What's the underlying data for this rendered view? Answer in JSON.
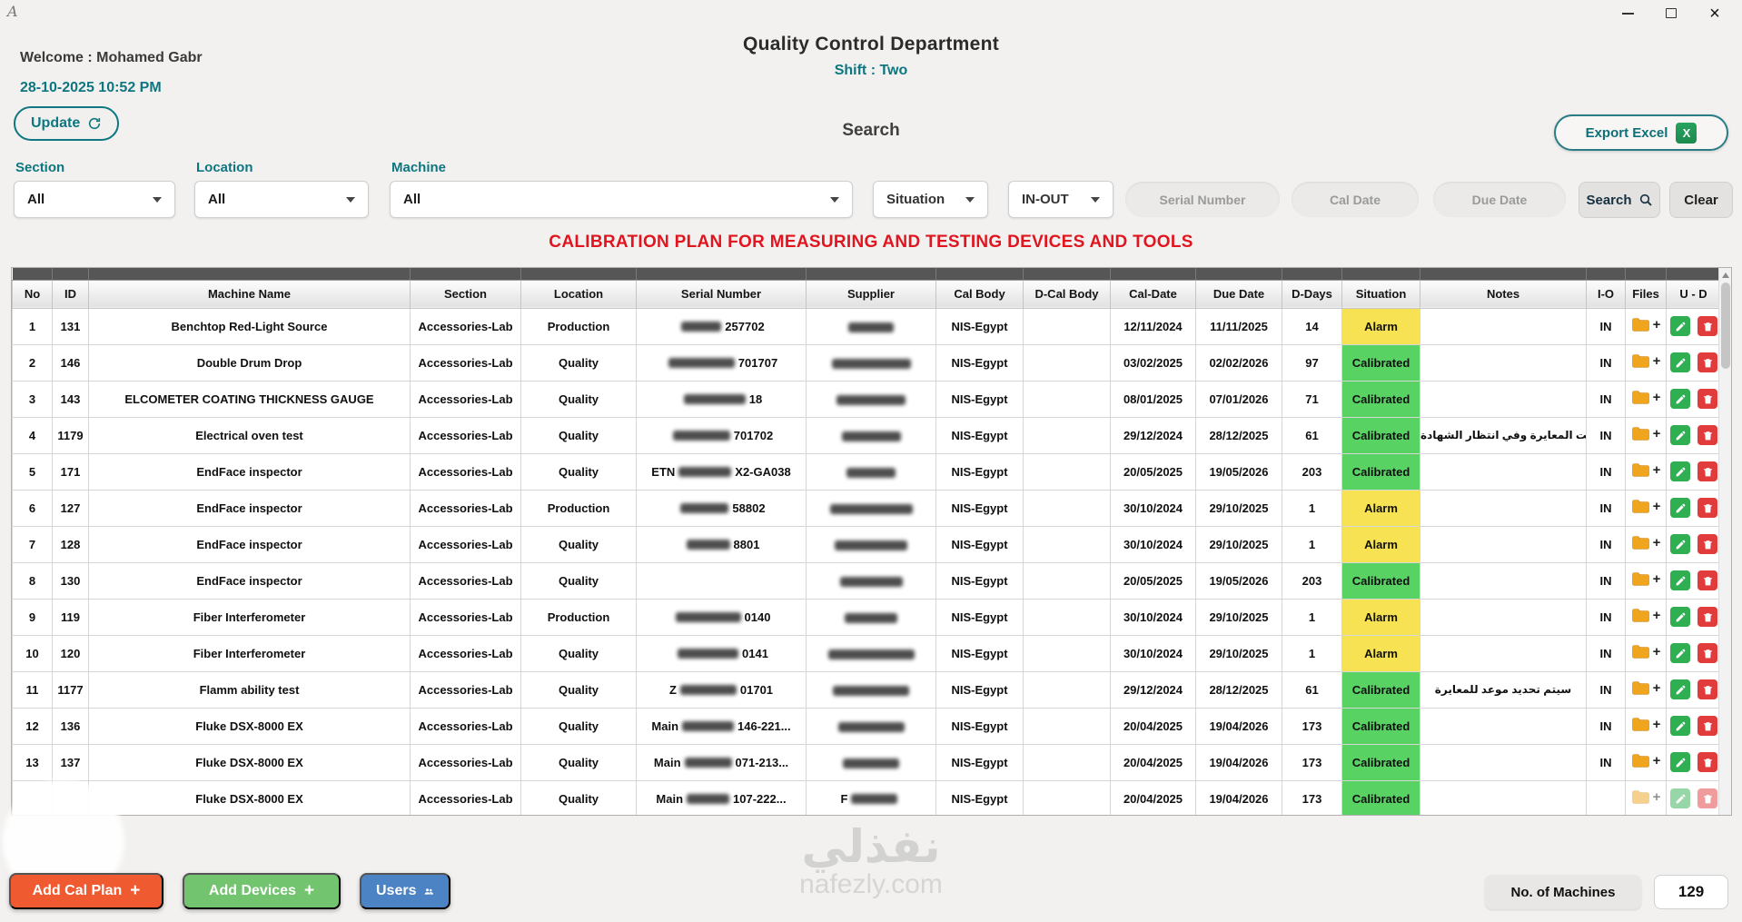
{
  "header": {
    "welcome": "Welcome : Mohamed Gabr",
    "datetime": "28-10-2025 10:52 PM",
    "title": "Quality Control Department",
    "shift": "Shift : Two",
    "update_label": "Update",
    "export_label": "Export Excel"
  },
  "search": {
    "heading": "Search",
    "section_label": "Section",
    "section_value": "All",
    "location_label": "Location",
    "location_value": "All",
    "machine_label": "Machine",
    "machine_value": "All",
    "situation_value": "Situation",
    "inout_value": "IN-OUT",
    "serial_placeholder": "Serial Number",
    "cal_date_placeholder": "Cal Date",
    "due_date_placeholder": "Due Date",
    "search_label": "Search",
    "clear_label": "Clear"
  },
  "table": {
    "title": "CALIBRATION PLAN FOR MEASURING AND TESTING DEVICES AND TOOLS",
    "columns": [
      "No",
      "ID",
      "Machine Name",
      "Section",
      "Location",
      "Serial Number",
      "Supplier",
      "Cal Body",
      "D-Cal Body",
      "Cal-Date",
      "Due Date",
      "D-Days",
      "Situation",
      "Notes",
      "I-O",
      "Files",
      "U - D"
    ],
    "situation_colors": {
      "Alarm": "#f6e253",
      "Calibrated": "#58d263"
    },
    "rows": [
      {
        "no": "1",
        "id": "131",
        "machine": "Benchtop Red-Light Source",
        "section": "Accessories-Lab",
        "location": "Production",
        "serial_pre": "",
        "serial_redacted": true,
        "serial_post": "257702",
        "supplier_pre": "",
        "supplier_redacted": true,
        "cal_body": "NIS-Egypt",
        "d_cal_body": "",
        "cal_date": "12/11/2024",
        "due_date": "11/11/2025",
        "d_days": "14",
        "situation": "Alarm",
        "notes": "",
        "io": "IN",
        "partial": false
      },
      {
        "no": "2",
        "id": "146",
        "machine": "Double Drum Drop",
        "section": "Accessories-Lab",
        "location": "Quality",
        "serial_pre": "",
        "serial_redacted": true,
        "serial_post": "701707",
        "supplier_pre": "",
        "supplier_redacted": true,
        "cal_body": "NIS-Egypt",
        "d_cal_body": "",
        "cal_date": "03/02/2025",
        "due_date": "02/02/2026",
        "d_days": "97",
        "situation": "Calibrated",
        "notes": "",
        "io": "IN",
        "partial": false
      },
      {
        "no": "3",
        "id": "143",
        "machine": "ELCOMETER COATING THICKNESS GAUGE",
        "section": "Accessories-Lab",
        "location": "Quality",
        "serial_pre": "",
        "serial_redacted": true,
        "serial_post": "18",
        "supplier_pre": "",
        "supplier_redacted": true,
        "cal_body": "NIS-Egypt",
        "d_cal_body": "",
        "cal_date": "08/01/2025",
        "due_date": "07/01/2026",
        "d_days": "71",
        "situation": "Calibrated",
        "notes": "",
        "io": "IN",
        "partial": false
      },
      {
        "no": "4",
        "id": "1179",
        "machine": "Electrical oven test",
        "section": "Accessories-Lab",
        "location": "Quality",
        "serial_pre": "",
        "serial_redacted": true,
        "serial_post": "701702",
        "supplier_pre": "",
        "supplier_redacted": true,
        "cal_body": "NIS-Egypt",
        "d_cal_body": "",
        "cal_date": "29/12/2024",
        "due_date": "28/12/2025",
        "d_days": "61",
        "situation": "Calibrated",
        "notes": "تمت المعايرة وفي انتظار الشهادة",
        "io": "IN",
        "partial": false
      },
      {
        "no": "5",
        "id": "171",
        "machine": "EndFace inspector",
        "section": "Accessories-Lab",
        "location": "Quality",
        "serial_pre": "ETN",
        "serial_redacted": true,
        "serial_post": "X2-GA038",
        "supplier_pre": "",
        "supplier_redacted": true,
        "cal_body": "NIS-Egypt",
        "d_cal_body": "",
        "cal_date": "20/05/2025",
        "due_date": "19/05/2026",
        "d_days": "203",
        "situation": "Calibrated",
        "notes": "",
        "io": "IN",
        "partial": false
      },
      {
        "no": "6",
        "id": "127",
        "machine": "EndFace inspector",
        "section": "Accessories-Lab",
        "location": "Production",
        "serial_pre": "",
        "serial_redacted": true,
        "serial_post": "58802",
        "supplier_pre": "",
        "supplier_redacted": true,
        "cal_body": "NIS-Egypt",
        "d_cal_body": "",
        "cal_date": "30/10/2024",
        "due_date": "29/10/2025",
        "d_days": "1",
        "situation": "Alarm",
        "notes": "",
        "io": "IN",
        "partial": false
      },
      {
        "no": "7",
        "id": "128",
        "machine": "EndFace inspector",
        "section": "Accessories-Lab",
        "location": "Quality",
        "serial_pre": "",
        "serial_redacted": true,
        "serial_post": "8801",
        "supplier_pre": "",
        "supplier_redacted": true,
        "cal_body": "NIS-Egypt",
        "d_cal_body": "",
        "cal_date": "30/10/2024",
        "due_date": "29/10/2025",
        "d_days": "1",
        "situation": "Alarm",
        "notes": "",
        "io": "IN",
        "partial": false
      },
      {
        "no": "8",
        "id": "130",
        "machine": "EndFace inspector",
        "section": "Accessories-Lab",
        "location": "Quality",
        "serial_pre": "",
        "serial_redacted": false,
        "serial_post": "",
        "supplier_pre": "",
        "supplier_redacted": true,
        "cal_body": "NIS-Egypt",
        "d_cal_body": "",
        "cal_date": "20/05/2025",
        "due_date": "19/05/2026",
        "d_days": "203",
        "situation": "Calibrated",
        "notes": "",
        "io": "IN",
        "partial": false
      },
      {
        "no": "9",
        "id": "119",
        "machine": "Fiber Interferometer",
        "section": "Accessories-Lab",
        "location": "Production",
        "serial_pre": "",
        "serial_redacted": true,
        "serial_post": "0140",
        "supplier_pre": "",
        "supplier_redacted": true,
        "cal_body": "NIS-Egypt",
        "d_cal_body": "",
        "cal_date": "30/10/2024",
        "due_date": "29/10/2025",
        "d_days": "1",
        "situation": "Alarm",
        "notes": "",
        "io": "IN",
        "partial": false
      },
      {
        "no": "10",
        "id": "120",
        "machine": "Fiber Interferometer",
        "section": "Accessories-Lab",
        "location": "Quality",
        "serial_pre": "",
        "serial_redacted": true,
        "serial_post": "0141",
        "supplier_pre": "",
        "supplier_redacted": true,
        "cal_body": "NIS-Egypt",
        "d_cal_body": "",
        "cal_date": "30/10/2024",
        "due_date": "29/10/2025",
        "d_days": "1",
        "situation": "Alarm",
        "notes": "",
        "io": "IN",
        "partial": false
      },
      {
        "no": "11",
        "id": "1177",
        "machine": "Flamm ability test",
        "section": "Accessories-Lab",
        "location": "Quality",
        "serial_pre": "Z",
        "serial_redacted": true,
        "serial_post": "01701",
        "supplier_pre": "",
        "supplier_redacted": true,
        "cal_body": "NIS-Egypt",
        "d_cal_body": "",
        "cal_date": "29/12/2024",
        "due_date": "28/12/2025",
        "d_days": "61",
        "situation": "Calibrated",
        "notes": "سيتم تحديد موعد للمعايرة",
        "io": "IN",
        "partial": false
      },
      {
        "no": "12",
        "id": "136",
        "machine": "Fluke DSX-8000 EX",
        "section": "Accessories-Lab",
        "location": "Quality",
        "serial_pre": "Main",
        "serial_redacted": true,
        "serial_post": "146-221...",
        "supplier_pre": "",
        "supplier_redacted": true,
        "cal_body": "NIS-Egypt",
        "d_cal_body": "",
        "cal_date": "20/04/2025",
        "due_date": "19/04/2026",
        "d_days": "173",
        "situation": "Calibrated",
        "notes": "",
        "io": "IN",
        "partial": false
      },
      {
        "no": "13",
        "id": "137",
        "machine": "Fluke DSX-8000 EX",
        "section": "Accessories-Lab",
        "location": "Quality",
        "serial_pre": "Main",
        "serial_redacted": true,
        "serial_post": "071-213...",
        "supplier_pre": "",
        "supplier_redacted": true,
        "cal_body": "NIS-Egypt",
        "d_cal_body": "",
        "cal_date": "20/04/2025",
        "due_date": "19/04/2026",
        "d_days": "173",
        "situation": "Calibrated",
        "notes": "",
        "io": "IN",
        "partial": false
      },
      {
        "no": "",
        "id": "",
        "machine": "Fluke DSX-8000 EX",
        "section": "Accessories-Lab",
        "location": "Quality",
        "serial_pre": "Main",
        "serial_redacted": true,
        "serial_post": "107-222...",
        "supplier_pre": "F",
        "supplier_redacted": true,
        "cal_body": "NIS-Egypt",
        "d_cal_body": "",
        "cal_date": "20/04/2025",
        "due_date": "19/04/2026",
        "d_days": "173",
        "situation": "Calibrated",
        "notes": "",
        "io": "",
        "partial": true
      }
    ]
  },
  "footer": {
    "add_cal_plan": "Add Cal Plan",
    "add_devices": "Add Devices",
    "users": "Users",
    "machines_label": "No. of Machines",
    "machines_count": "129"
  },
  "watermark": {
    "line1": "نفذلي",
    "line2": "nafezly.com"
  },
  "icons": {
    "app-icon": "cursive-A",
    "minimize-icon": "horizontal-bar",
    "maximize-icon": "square-outline",
    "close-icon": "×",
    "refresh-icon": "circular-arrow",
    "excel-icon": "green-square-X",
    "chevron-down-icon": "▾",
    "search-icon": "magnifier",
    "folder-icon": "orange-folder",
    "edit-icon": "white-pencil-on-green",
    "delete-icon": "white-trash-on-red",
    "users-icon": "two-people"
  }
}
